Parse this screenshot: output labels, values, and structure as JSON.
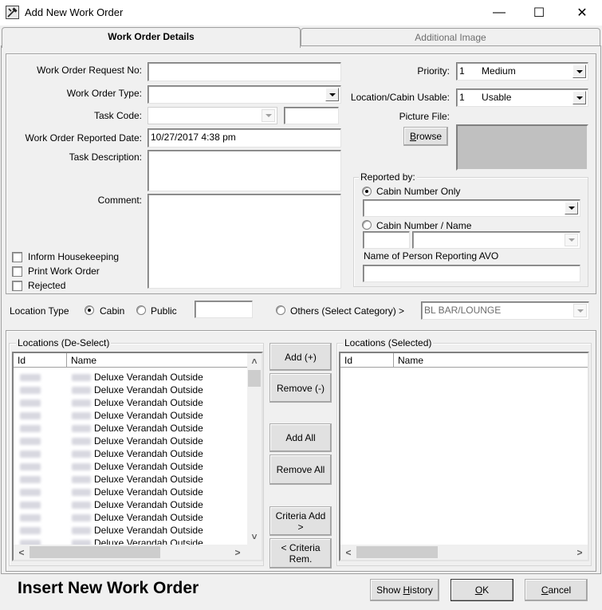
{
  "window": {
    "title": "Add New Work Order",
    "controls": {
      "minimize": "—",
      "maximize": "☐",
      "close": "✕"
    }
  },
  "tabs": [
    {
      "label": "Work Order Details",
      "active": true
    },
    {
      "label": "Additional Image",
      "active": false
    }
  ],
  "form": {
    "request_no": {
      "label": "Work Order Request No:",
      "value": ""
    },
    "type": {
      "label": "Work Order Type:",
      "value": ""
    },
    "task_code": {
      "label": "Task Code:",
      "value": "",
      "extra_value": ""
    },
    "reported_date": {
      "label": "Work Order Reported Date:",
      "value": "10/27/2017 4:38 pm"
    },
    "task_description": {
      "label": "Task Description:",
      "value": ""
    },
    "comment": {
      "label": "Comment:",
      "value": ""
    },
    "checkboxes": [
      {
        "label": "Inform Housekeeping",
        "checked": false
      },
      {
        "label": "Print Work Order",
        "checked": false
      },
      {
        "label": "Rejected",
        "checked": false
      }
    ],
    "priority": {
      "label": "Priority:",
      "code": "1",
      "value": "Medium"
    },
    "cabin_usable": {
      "label": "Location/Cabin Usable:",
      "code": "1",
      "value": "Usable"
    },
    "picture_file": {
      "label": "Picture File:",
      "browse_label": "Browse",
      "browse_mnemonic": "B",
      "browse_rest": "rowse"
    },
    "reported_by": {
      "legend": "Reported by:",
      "cabin_only": {
        "label": "Cabin Number Only",
        "selected": true,
        "value": ""
      },
      "cabin_name": {
        "label": "Cabin Number / Name",
        "selected": false,
        "cabin": "",
        "name": ""
      },
      "person": {
        "label": "Name of Person Reporting AVO",
        "value": ""
      }
    }
  },
  "location_type": {
    "label": "Location Type",
    "options": [
      {
        "label": "Cabin",
        "selected": true
      },
      {
        "label": "Public",
        "selected": false
      }
    ],
    "filter_value": "",
    "others": {
      "label": "Others (Select Category) >",
      "selected": false,
      "value": "BL BAR/LOUNGE"
    }
  },
  "locations_deselect": {
    "legend": "Locations (De-Select)",
    "columns": [
      "Id",
      "Name"
    ],
    "rows": [
      {
        "name": "Deluxe Verandah Outside"
      },
      {
        "name": "Deluxe Verandah Outside"
      },
      {
        "name": "Deluxe Verandah Outside"
      },
      {
        "name": "Deluxe Verandah Outside"
      },
      {
        "name": "Deluxe Verandah Outside"
      },
      {
        "name": "Deluxe Verandah Outside"
      },
      {
        "name": "Deluxe Verandah Outside"
      },
      {
        "name": "Deluxe Verandah Outside"
      },
      {
        "name": "Deluxe Verandah Outside"
      },
      {
        "name": "Deluxe Verandah Outside"
      },
      {
        "name": "Deluxe Verandah Outside"
      },
      {
        "name": "Deluxe Verandah Outside"
      },
      {
        "name": "Deluxe Verandah Outside"
      },
      {
        "name": "Deluxe Verandah Outside"
      }
    ]
  },
  "locations_selected": {
    "legend": "Locations (Selected)",
    "columns": [
      "Id",
      "Name"
    ],
    "rows": []
  },
  "transfer_buttons": {
    "add": "Add (+)",
    "remove": "Remove (-)",
    "add_all": "Add All",
    "remove_all": "Remove All",
    "criteria_add_1": "Criteria Add",
    "criteria_add_2": ">",
    "criteria_rem_1": "< Criteria",
    "criteria_rem_2": "Rem."
  },
  "footer": {
    "heading": "Insert New Work Order",
    "show_history": {
      "pre": "Show ",
      "mn": "H",
      "post": "istory"
    },
    "ok": {
      "mn": "O",
      "post": "K"
    },
    "cancel": {
      "mn": "C",
      "post": "ancel"
    }
  },
  "scroll_glyphs": {
    "up": "˄",
    "down": "˅",
    "left": "<",
    "right": ">"
  }
}
